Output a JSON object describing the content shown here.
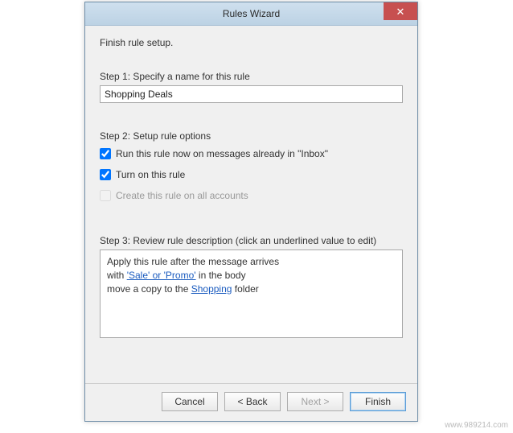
{
  "window": {
    "title": "Rules Wizard"
  },
  "heading": "Finish rule setup.",
  "step1": {
    "label": "Step 1: Specify a name for this rule",
    "value": "Shopping Deals"
  },
  "step2": {
    "label": "Step 2: Setup rule options",
    "opt_run_now": "Run this rule now on messages already in \"Inbox\"",
    "opt_turn_on": "Turn on this rule",
    "opt_all_accounts": "Create this rule on all accounts"
  },
  "step3": {
    "label": "Step 3: Review rule description (click an underlined value to edit)",
    "line1": "Apply this rule after the message arrives",
    "line2_prefix": "with ",
    "line2_link": "'Sale' or 'Promo'",
    "line2_suffix": " in the body",
    "line3_prefix": "move a copy to the ",
    "line3_link": "Shopping",
    "line3_suffix": " folder"
  },
  "buttons": {
    "cancel": "Cancel",
    "back": "< Back",
    "next": "Next >",
    "finish": "Finish"
  },
  "watermark": "www.989214.com"
}
